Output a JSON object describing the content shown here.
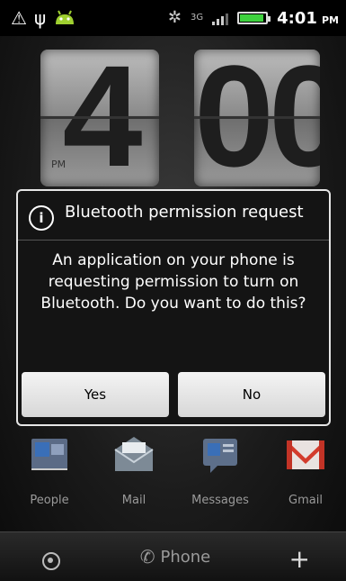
{
  "status_bar": {
    "network_type": "3G",
    "time": "4:01",
    "time_suffix": "PM",
    "battery_level": 0.85,
    "battery_color": "#3fd23f"
  },
  "clock": {
    "hour": "4",
    "minute": "00",
    "ampm": "PM"
  },
  "dialog": {
    "title": "Bluetooth permission request",
    "icon": "info-icon",
    "message": "An application on your phone is requesting permission to turn on Bluetooth. Do you want to do this?",
    "buttons": {
      "yes": "Yes",
      "no": "No"
    }
  },
  "dock": {
    "items": [
      {
        "label": "People",
        "icon": "people-icon"
      },
      {
        "label": "Mail",
        "icon": "mail-icon"
      },
      {
        "label": "Messages",
        "icon": "messages-icon"
      },
      {
        "label": "Gmail",
        "icon": "gmail-icon"
      }
    ]
  },
  "bottom_bar": {
    "phone_label": "Phone"
  },
  "colors": {
    "gmail_red": "#d33b2c",
    "people_blue": "#3a6fb8",
    "dialog_border": "#e6e6e6"
  }
}
